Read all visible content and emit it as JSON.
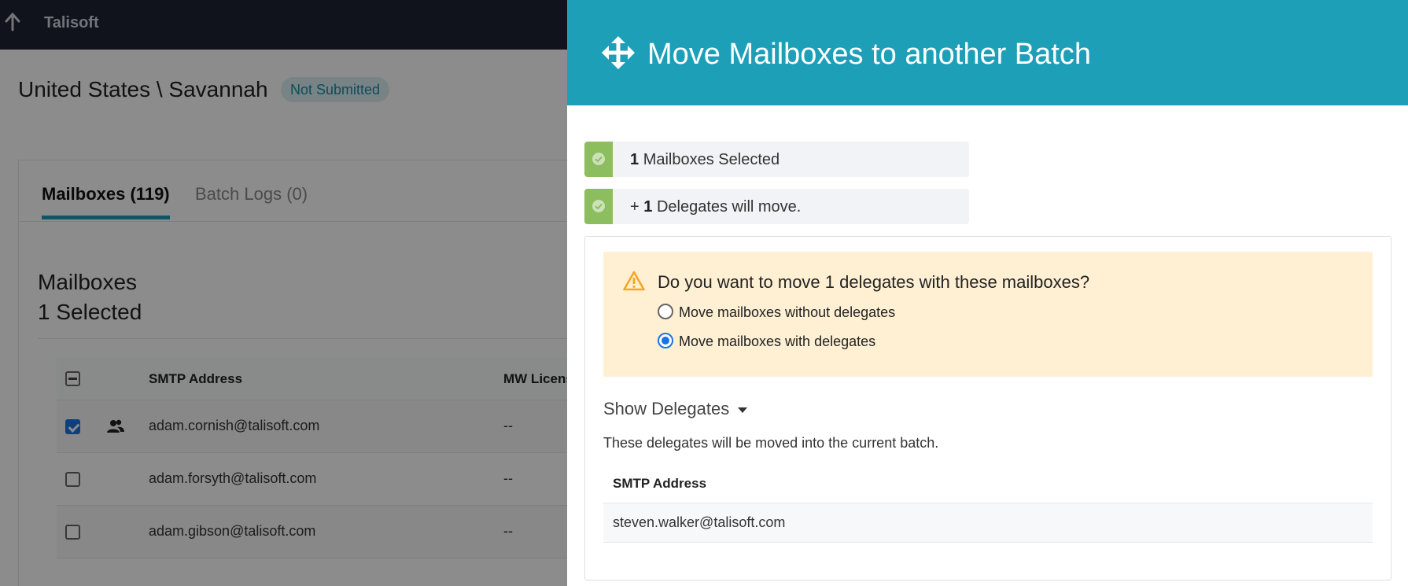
{
  "app": {
    "brand": "Talisoft"
  },
  "page": {
    "title": "United States \\ Savannah",
    "status": "Not Submitted",
    "tabs": [
      {
        "label": "Mailboxes (119)",
        "active": true
      },
      {
        "label": "Batch Logs (0)",
        "active": false
      }
    ],
    "section_title": "Mailboxes",
    "section_subtitle": "1 Selected",
    "table": {
      "columns": [
        "SMTP Address",
        "MW Licens"
      ],
      "rows": [
        {
          "checked": true,
          "delegate_icon": "people-icon",
          "smtp": "adam.cornish@talisoft.com",
          "license": "--"
        },
        {
          "checked": false,
          "smtp": "adam.forsyth@talisoft.com",
          "license": "--"
        },
        {
          "checked": false,
          "smtp": "adam.gibson@talisoft.com",
          "license": "--"
        }
      ]
    }
  },
  "panel": {
    "title": "Move Mailboxes to another Batch",
    "icon": "move-icon",
    "selected": {
      "count": "1",
      "text": "Mailboxes Selected"
    },
    "delegates_move": {
      "prefix": "+",
      "count": "1",
      "text": "Delegates will move."
    },
    "question": "Do you want to move 1 delegates with these mailboxes?",
    "options": [
      {
        "label": "Move mailboxes without delegates",
        "selected": false
      },
      {
        "label": "Move mailboxes with delegates",
        "selected": true
      }
    ],
    "show_delegates_label": "Show Delegates",
    "delegates_description": "These delegates will be moved into the current batch.",
    "delegates_table": {
      "column": "SMTP Address",
      "rows": [
        "steven.walker@talisoft.com"
      ]
    }
  },
  "colors": {
    "header_teal": "#1e9fb8",
    "success_green": "#8cbd5f",
    "warning_bg": "#fff0d4",
    "warning_icon": "#f5a623",
    "topbar": "#1e2433"
  }
}
